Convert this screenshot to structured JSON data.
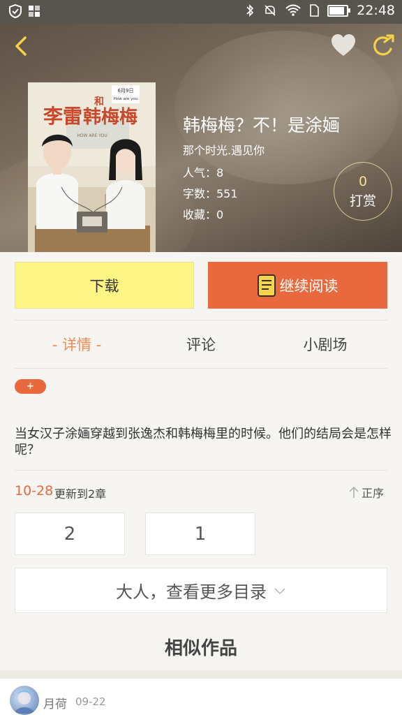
{
  "status_bar": {
    "time": "22:48",
    "icons": [
      "shield-icon",
      "apps-icon",
      "bluetooth-icon",
      "mute-icon",
      "wifi-icon",
      "sim-icon",
      "battery-icon"
    ],
    "battery_level": 0.8
  },
  "header": {
    "back_icon": "chevron-left-icon",
    "favorite_icon": "heart-icon",
    "share_icon": "share-icon"
  },
  "book": {
    "cover": {
      "title_chars": "李雷和韩梅梅",
      "date_badge": "6月9日",
      "badge_text": "How are you",
      "tagline": "HOW ARE YOU"
    },
    "title": "韩梅梅？不！是涂婳",
    "author": "那个时光.遇见你",
    "popularity": "人气：8",
    "word_count": "字数：551",
    "favorites": "收藏：0",
    "tip_count": "0",
    "tip_label": "打赏"
  },
  "actions": {
    "download": "下载",
    "continue_reading": "继续阅读"
  },
  "tabs": [
    {
      "label": "- 详情 -",
      "active": true
    },
    {
      "label": "评论",
      "active": false
    },
    {
      "label": "小剧场",
      "active": false
    }
  ],
  "tag_add": "+",
  "description": "当女汉子涂婳穿越到张逸杰和韩梅梅里的时候。他们的结局会是怎样呢？",
  "update": {
    "date": "10-28",
    "text": "更新到2章",
    "sort_label": "正序"
  },
  "chapters": [
    "2",
    "1"
  ],
  "more_catalog": "大人，查看更多目录",
  "similar_title": "相似作品",
  "comment_preview": {
    "user": "月荷",
    "date": "09-22"
  },
  "colors": {
    "accent": "#e7693d",
    "download_bg": "#fdf486",
    "active_tab": "#ee8a55"
  }
}
